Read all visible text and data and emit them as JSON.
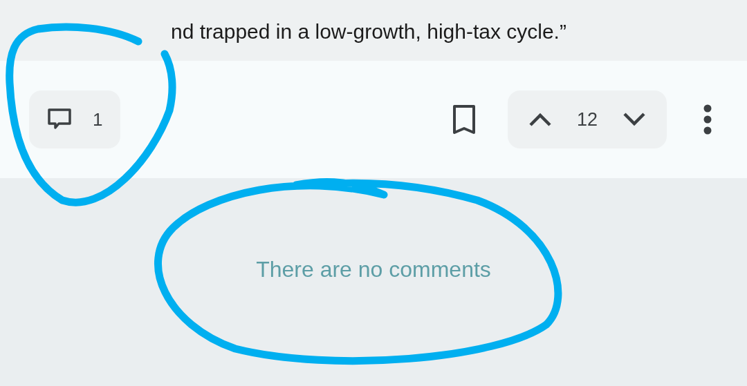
{
  "article": {
    "lines": [
      "nd trapped in a low-growth, high-tax cycle.”"
    ]
  },
  "actions": {
    "comments": {
      "count": "1"
    },
    "bookmarked": false,
    "votes": {
      "score": "12"
    }
  },
  "comments": {
    "empty_message": "There are no comments"
  }
}
